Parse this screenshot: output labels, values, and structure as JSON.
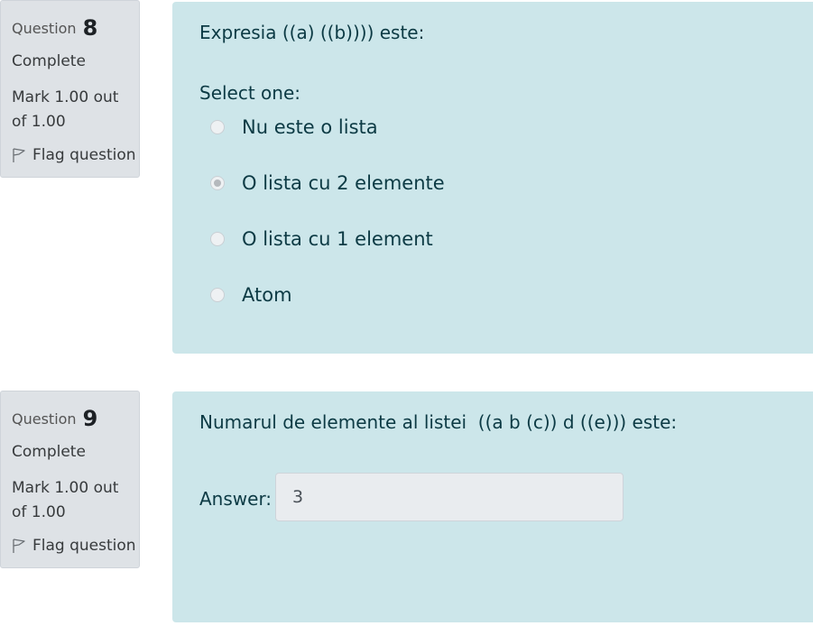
{
  "questions": [
    {
      "label": "Question",
      "number": "8",
      "state": "Complete",
      "grade": "Mark 1.00 out of 1.00",
      "flag_label": "Flag question",
      "text": "Expresia ((a) ((b)))) este:",
      "prompt": "Select one:",
      "options": [
        {
          "label": "Nu este o lista",
          "selected": false
        },
        {
          "label": "O lista cu 2 elemente",
          "selected": true
        },
        {
          "label": "O lista cu 1 element",
          "selected": false
        },
        {
          "label": "Atom",
          "selected": false
        }
      ]
    },
    {
      "label": "Question",
      "number": "9",
      "state": "Complete",
      "grade": "Mark 1.00 out of 1.00",
      "flag_label": "Flag question",
      "text": "Numarul de elemente al listei  ((a b (c)) d ((e))) este:",
      "answer_label": "Answer:",
      "answer_value": "3"
    }
  ],
  "colors": {
    "info_background": "#dee2e6",
    "content_background": "#cce6ea",
    "input_background": "#e9ecef"
  },
  "icons": {
    "flag": "flag-icon"
  }
}
